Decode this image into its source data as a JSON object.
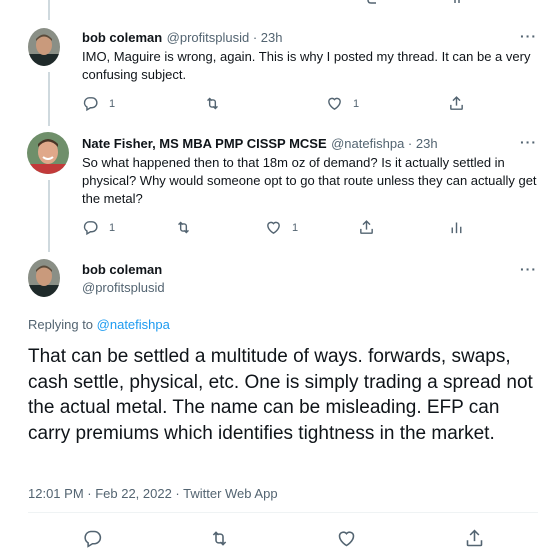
{
  "tweets": [
    {
      "name": "bob coleman",
      "handle": "@profitsplusid",
      "time": "23h",
      "text": "IMO,  Maguire is wrong, again. This is why I posted my thread. It can be a very confusing subject.",
      "replies": "1",
      "retweets": "",
      "likes": "1"
    },
    {
      "name": "Nate Fisher, MS MBA PMP CISSP MCSE",
      "handle": "@natefishpa",
      "time": "23h",
      "text": "So what happened then to that 18m oz of demand? Is it actually settled in physical? Why would someone opt to go that route unless they can actually get the metal?",
      "replies": "1",
      "retweets": "",
      "likes": "1"
    }
  ],
  "focused": {
    "name": "bob coleman",
    "handle": "@profitsplusid",
    "replying_label": "Replying to ",
    "replying_to": "@natefishpa",
    "text": "That can be settled a multitude of ways. forwards, swaps, cash settle, physical, etc. One is simply trading a spread not the actual metal. The name can be misleading. EFP can carry premiums which identifies tightness in the market.",
    "meta": "12:01 PM · Feb 22, 2022 · Twitter Web App"
  },
  "ui": {
    "dot_sep": " · ",
    "more": "···"
  },
  "colors": {
    "link": "#1d9bf0",
    "secondary": "#536471",
    "thread_line": "#cfd9de"
  },
  "icons": [
    "reply-icon",
    "retweet-icon",
    "like-icon",
    "share-icon",
    "analytics-icon",
    "more-icon"
  ]
}
